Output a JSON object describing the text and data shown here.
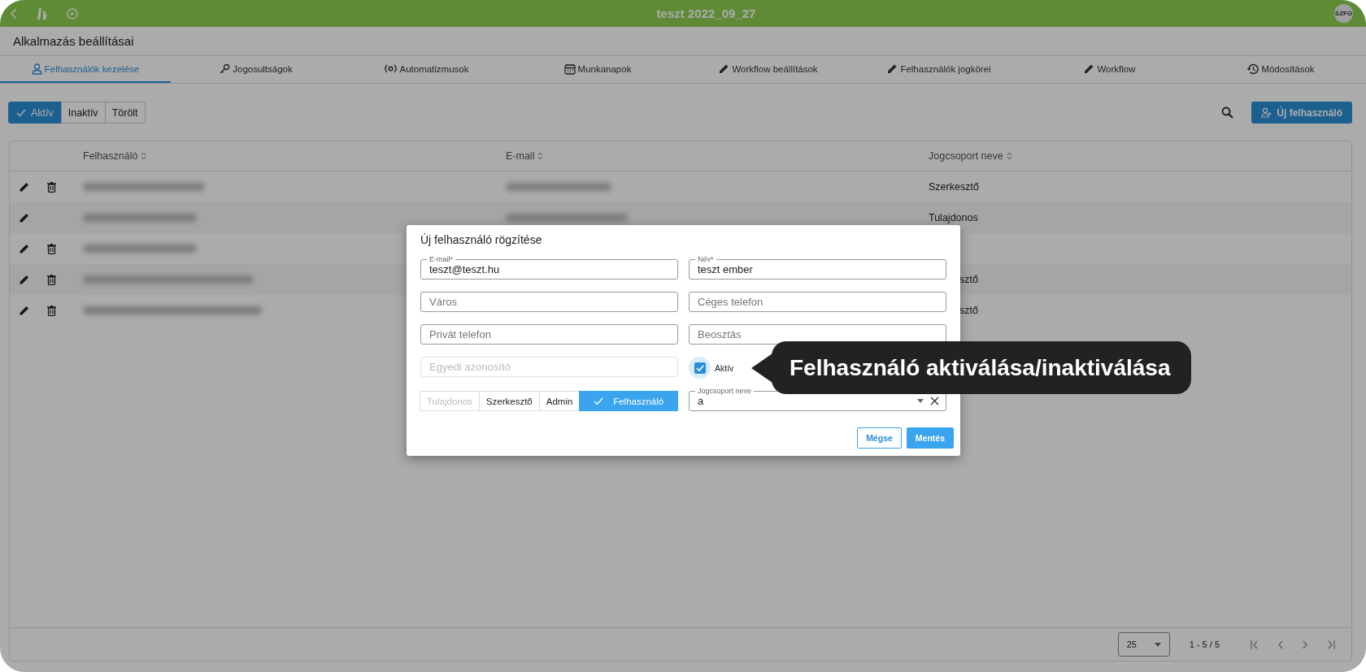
{
  "topbar": {
    "title": "teszt 2022_09_27",
    "avatar": "SZFG"
  },
  "page_title": "Alkalmazás beállításai",
  "tabs": [
    {
      "label": "Felhasználók kezelése",
      "selected": true
    },
    {
      "label": "Jogosultságok",
      "selected": false
    },
    {
      "label": "Automatizmusok",
      "selected": false
    },
    {
      "label": "Munkanapok",
      "selected": false
    },
    {
      "label": "Workflow beállítások",
      "selected": false
    },
    {
      "label": "Felhasználók jogkörei",
      "selected": false
    },
    {
      "label": "Workflow",
      "selected": false
    },
    {
      "label": "Módosítások",
      "selected": false
    }
  ],
  "status_filter": [
    {
      "label": "Aktív",
      "selected": true
    },
    {
      "label": "Inaktív",
      "selected": false
    },
    {
      "label": "Törölt",
      "selected": false
    }
  ],
  "new_user_button": "Új felhasználó",
  "table": {
    "columns": [
      "Felhasználó",
      "E-mail",
      "Jogcsoport neve"
    ],
    "rows": [
      {
        "deletable": true,
        "role": "Szerkesztő",
        "partly_hidden": false
      },
      {
        "deletable": false,
        "role": "Tulajdonos",
        "partly_hidden": false
      },
      {
        "deletable": true
      },
      {
        "deletable": true,
        "role": "sztő",
        "partly_hidden": true
      },
      {
        "deletable": true,
        "role": "sztő",
        "partly_hidden": true
      }
    ]
  },
  "pagination": {
    "page_size": "25",
    "range": "1 - 5 / 5"
  },
  "dialog": {
    "title": "Új felhasználó rögzítése",
    "fields": [
      {
        "label": "E-mail*",
        "value": "teszt@teszt.hu",
        "disabled": false
      },
      {
        "label": "Név*",
        "value": "teszt ember",
        "disabled": false
      },
      {
        "placeholder": "Város",
        "disabled": false
      },
      {
        "placeholder": "Céges telefon",
        "disabled": false
      },
      {
        "placeholder": "Privát telefon",
        "disabled": false
      },
      {
        "placeholder": "Beosztás",
        "disabled": false
      },
      {
        "placeholder": "Egyedi azonosító",
        "disabled": true
      }
    ],
    "active_checkbox": {
      "label": "Aktív",
      "checked": true
    },
    "roles": [
      {
        "label": "Tulajdonos",
        "selected": false,
        "disabled": true
      },
      {
        "label": "Szerkesztő",
        "selected": false,
        "disabled": false
      },
      {
        "label": "Admin",
        "selected": false,
        "disabled": false
      },
      {
        "label": "Felhasználó",
        "selected": true,
        "disabled": false
      }
    ],
    "group_select": {
      "label": "Jogcsoport neve",
      "value": "a"
    },
    "cancel_button": "Mégse",
    "save_button": "Mentés"
  },
  "tooltip": "Felhasználó aktiválása/inaktiválása"
}
